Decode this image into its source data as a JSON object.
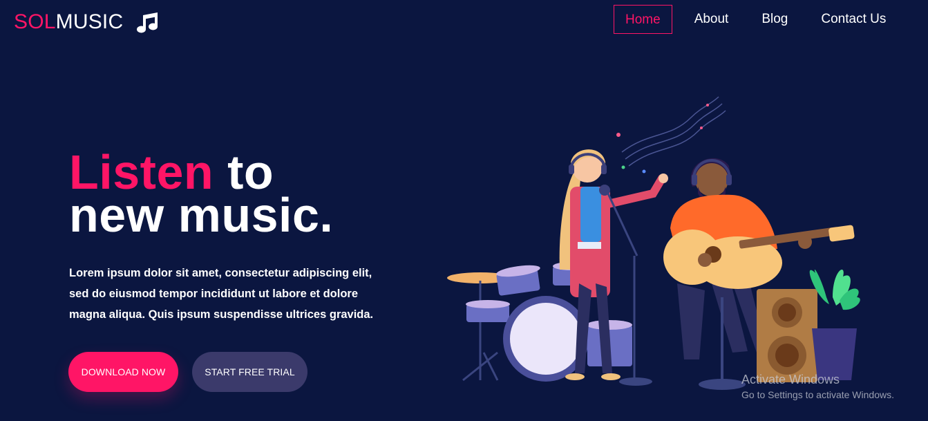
{
  "brand": {
    "logo_accent": "SOL",
    "logo_main": "MUSIC",
    "logo_icon": "music-note-icon",
    "accent_color": "#ff1566"
  },
  "nav": {
    "items": [
      {
        "label": "Home",
        "active": true
      },
      {
        "label": "About"
      },
      {
        "label": "Blog"
      },
      {
        "label": "Contact Us"
      }
    ]
  },
  "hero": {
    "title_highlight": "Listen",
    "title_rest_1": " to",
    "title_line_2": "new music.",
    "description": "Lorem ipsum dolor sit amet, consectetur adipiscing elit, sed do eiusmod tempor incididunt ut labore et dolore magna aliqua. Quis ipsum suspendisse ultrices gravida.",
    "download_button": "DOWNLOAD NOW",
    "trial_button": "START FREE TRIAL"
  },
  "watermark": {
    "title": "Activate Windows",
    "subtitle": "Go to Settings to activate Windows."
  },
  "colors": {
    "background": "#0b1640",
    "accent": "#ff1566",
    "secondary_button": "#3b3a6b"
  }
}
